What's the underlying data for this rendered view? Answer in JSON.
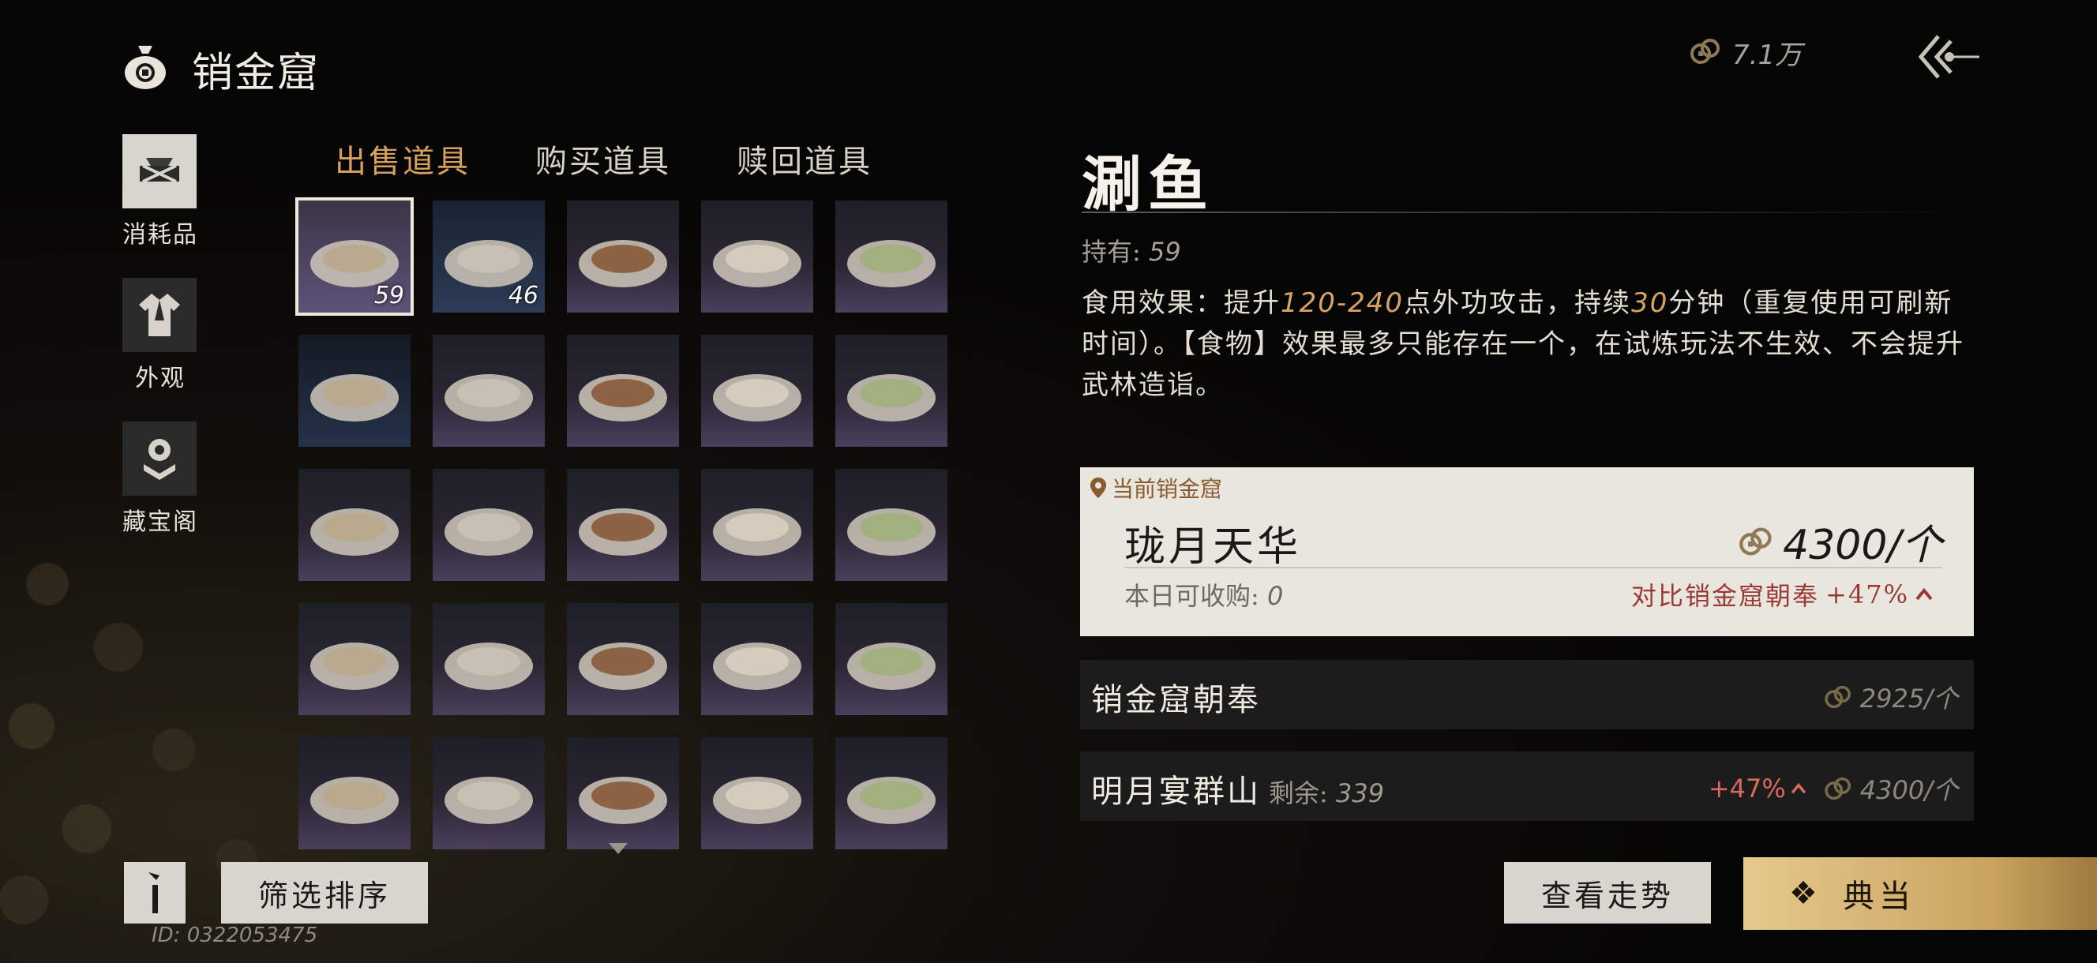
{
  "header": {
    "title": "销金窟",
    "currency_value": "7.1万"
  },
  "categories": [
    {
      "label": "消耗品",
      "active": true
    },
    {
      "label": "外观",
      "active": false
    },
    {
      "label": "藏宝阁",
      "active": false
    }
  ],
  "tabs": [
    {
      "label": "出售道具",
      "active": true
    },
    {
      "label": "购买道具",
      "active": false
    },
    {
      "label": "赎回道具",
      "active": false
    }
  ],
  "grid_items": [
    {
      "icon": "clay-pot-stew-icon",
      "count": "59",
      "selected": true
    },
    {
      "icon": "porcelain-jar-icon",
      "count": "46"
    },
    {
      "icon": "roasted-meat-icon",
      "count": ""
    },
    {
      "icon": "egg-dish-icon",
      "count": ""
    },
    {
      "icon": "cucumber-plate-icon",
      "count": ""
    },
    {
      "icon": "fish-plate-icon",
      "count": ""
    },
    {
      "icon": "braised-meat-bowl-icon",
      "count": ""
    },
    {
      "icon": "grilled-fish-plate-icon",
      "count": ""
    },
    {
      "icon": "stir-fry-plate-icon",
      "count": ""
    },
    {
      "icon": "tofu-plate-icon",
      "count": ""
    },
    {
      "icon": "soup-bowl-icon",
      "count": ""
    },
    {
      "icon": "congee-bowl-icon",
      "count": ""
    },
    {
      "icon": "steamed-buns-icon",
      "count": ""
    },
    {
      "icon": "green-drink-glass-icon",
      "count": ""
    },
    {
      "icon": "shaved-ice-icon",
      "count": ""
    },
    {
      "icon": "clay-pot-icon",
      "count": ""
    },
    {
      "icon": "green-tea-bowl-icon",
      "count": ""
    },
    {
      "icon": "dumpling-bowl-icon",
      "count": ""
    },
    {
      "icon": "meat-pot-icon",
      "count": ""
    },
    {
      "icon": "skewer-icon",
      "count": ""
    },
    {
      "icon": "vegetable-plate-icon",
      "count": ""
    },
    {
      "icon": "noodle-plate-icon",
      "count": ""
    },
    {
      "icon": "wine-jar-icon",
      "count": ""
    },
    {
      "icon": "rice-ball-icon",
      "count": ""
    },
    {
      "icon": "wonton-bowl-icon",
      "count": ""
    }
  ],
  "buttons": {
    "filter_label": "筛选排序",
    "trend_label": "查看走势",
    "pawn_label": "典当",
    "pawn_icon": "❖"
  },
  "user_id": "ID: 0322053475",
  "detail": {
    "name": "涮鱼",
    "held_label": "持有: ",
    "held_value": "59",
    "desc_1": "食用效果：提升",
    "desc_range": "120-240",
    "desc_2": "点外功攻击，持续",
    "desc_minutes": "30",
    "desc_3": "分钟（重复使用可刷新时间）。【食物】效果最多只能存在一个，在试炼玩法不生效、不会提升武林造诣。"
  },
  "current_market": {
    "tag": "当前销金窟",
    "name": "珑月天华",
    "price": "4300/个",
    "today_label": "本日可收购: ",
    "today_value": "0",
    "compare_label": "对比销金窟朝奉",
    "compare_pct": "+47%"
  },
  "markets": [
    {
      "name": "销金窟朝奉",
      "stock_label": "",
      "stock_value": "",
      "pct": "",
      "price": "2925/个"
    },
    {
      "name": "明月宴群山",
      "stock_label": "剩余: ",
      "stock_value": "339",
      "pct": "+47%",
      "price": "4300/个"
    }
  ],
  "colors": {
    "accent": "#d7a15a",
    "positive": "#d86a5e",
    "compare": "#9a3a34",
    "pawn_gold": "#d6b574"
  }
}
